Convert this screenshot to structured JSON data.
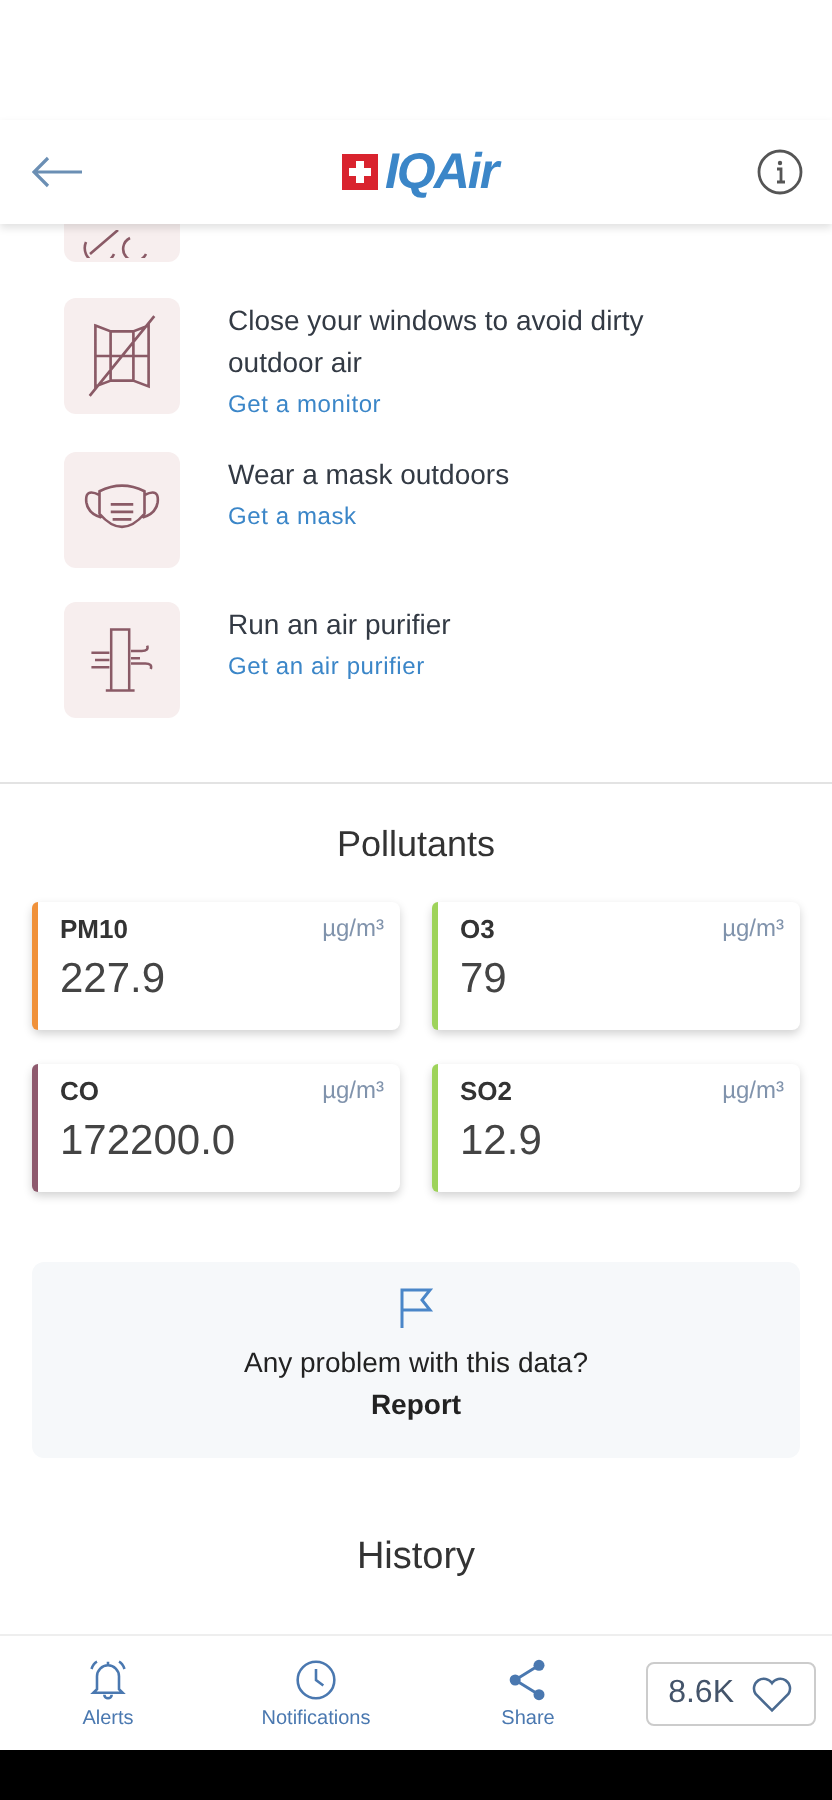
{
  "header": {
    "logo": "IQAir"
  },
  "recommendations": [
    {
      "kind": "window",
      "text": "Close your windows to avoid dirty outdoor air",
      "link": "Get a monitor"
    },
    {
      "kind": "mask",
      "text": "Wear a mask outdoors",
      "link": "Get a mask"
    },
    {
      "kind": "purifier",
      "text": "Run an air purifier",
      "link": "Get an air purifier"
    }
  ],
  "pollutants": {
    "title": "Pollutants",
    "items": [
      {
        "name": "PM10",
        "unit": "µg/m³",
        "value": "227.9",
        "color": "#f0913a"
      },
      {
        "name": "O3",
        "unit": "µg/m³",
        "value": "79",
        "color": "#9ed35a"
      },
      {
        "name": "CO",
        "unit": "µg/m³",
        "value": "172200.0",
        "color": "#8e5a6e"
      },
      {
        "name": "SO2",
        "unit": "µg/m³",
        "value": "12.9",
        "color": "#9ed35a"
      }
    ]
  },
  "report": {
    "question": "Any problem with this data?",
    "action": "Report"
  },
  "history": {
    "title": "History"
  },
  "bottom_nav": [
    {
      "kind": "alerts",
      "label": "Alerts"
    },
    {
      "kind": "notifications",
      "label": "Notifications"
    },
    {
      "kind": "share",
      "label": "Share"
    }
  ],
  "likes": {
    "count": "8.6K"
  }
}
